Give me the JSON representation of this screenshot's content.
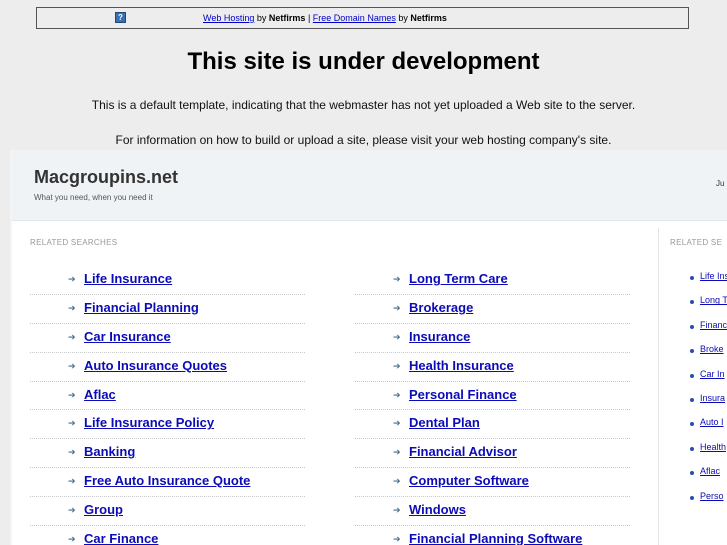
{
  "banner": {
    "icon": "question-mark-icon",
    "link1": "Web Hosting",
    "by1": "by",
    "brand1": "Netfirms",
    "sep": "|",
    "link2": "Free Domain Names",
    "by2": "by",
    "brand2": "Netfirms"
  },
  "dev": {
    "title": "This site is under development",
    "line1": "This is a default template, indicating that the webmaster has not yet uploaded a Web site to the server.",
    "line2": "For information on how to build or upload a site, please visit your web hosting company's site."
  },
  "header": {
    "site_name": "Macgroupins.net",
    "tagline": "What you need, when you need it",
    "right_text": "Ju"
  },
  "main": {
    "section_label": "RELATED SEARCHES",
    "col1": [
      "Life Insurance",
      "Financial Planning",
      "Car Insurance",
      "Auto Insurance Quotes",
      "Aflac",
      "Life Insurance Policy",
      "Banking",
      "Free Auto Insurance Quote",
      "Group",
      "Car Finance"
    ],
    "col2": [
      "Long Term Care",
      "Brokerage",
      "Insurance",
      "Health Insurance",
      "Personal Finance",
      "Dental Plan",
      "Financial Advisor",
      "Computer Software",
      "Windows",
      "Financial Planning Software"
    ]
  },
  "side": {
    "section_label": "RELATED SE",
    "items": [
      "Life Ins",
      "Long T",
      "Financ",
      "Broke",
      "Car In",
      "Insura",
      "Auto I",
      "Health",
      "Aflac",
      "Perso"
    ]
  },
  "colors": {
    "link": "#0b0bb8",
    "background": "#ededed",
    "header_bg": "#f0f3f6"
  }
}
